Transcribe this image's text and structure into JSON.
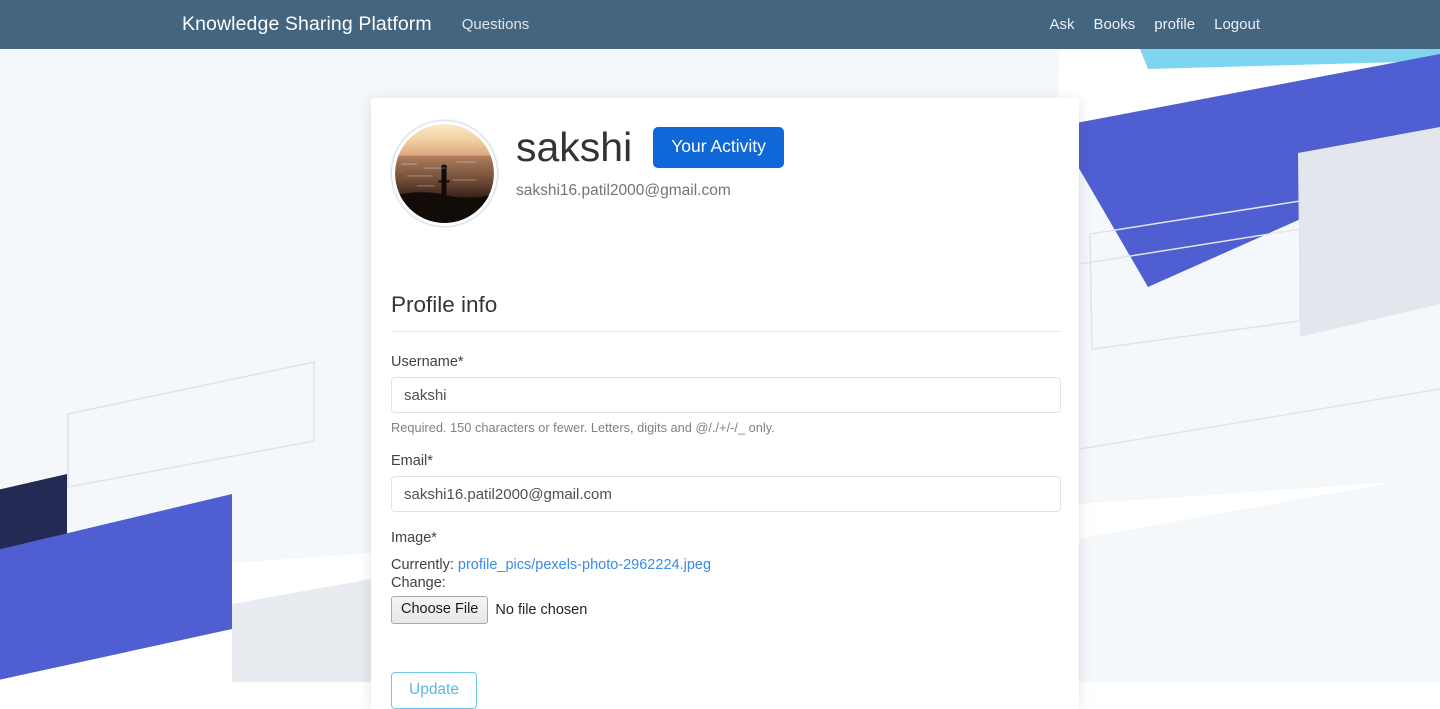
{
  "navbar": {
    "brand": "Knowledge Sharing Platform",
    "left_links": [
      {
        "label": "Questions",
        "name": "nav-link-questions"
      }
    ],
    "right_links": [
      {
        "label": "Ask",
        "name": "nav-link-ask"
      },
      {
        "label": "Books",
        "name": "nav-link-books"
      },
      {
        "label": "profile",
        "name": "nav-link-profile"
      },
      {
        "label": "Logout",
        "name": "nav-link-logout"
      }
    ],
    "background_color": "#44657f",
    "text_color": "#ffffff"
  },
  "profile": {
    "username": "sakshi",
    "email": "sakshi16.patil2000@gmail.com",
    "activity_button": "Your Activity",
    "activity_button_color": "#1068d8",
    "avatar_alt": "profile-avatar-sunset-ocean"
  },
  "section": {
    "title": "Profile info"
  },
  "form": {
    "username": {
      "label": "Username*",
      "value": "sakshi",
      "help": "Required. 150 characters or fewer. Letters, digits and @/./+/-/_ only."
    },
    "email": {
      "label": "Email*",
      "value": "sakshi16.patil2000@gmail.com"
    },
    "image": {
      "label": "Image*",
      "currently_label": "Currently:",
      "current_file": "profile_pics/pexels-photo-2962224.jpeg",
      "current_file_color": "#3b8bea",
      "change_label": "Change:",
      "choose_file_button": "Choose File",
      "no_file_text": "No file chosen"
    },
    "submit_button": "Update",
    "submit_button_color": "#5ab9e3"
  },
  "background": {
    "page_color": "#ffffff",
    "pale_panel_color": "#f4f8fb",
    "blue_band_color": "#4f5fd1",
    "cyan_accent_color": "#7fd4ee",
    "navy_block_color": "#232b54",
    "gray_panel_color": "#e3e7ed"
  }
}
